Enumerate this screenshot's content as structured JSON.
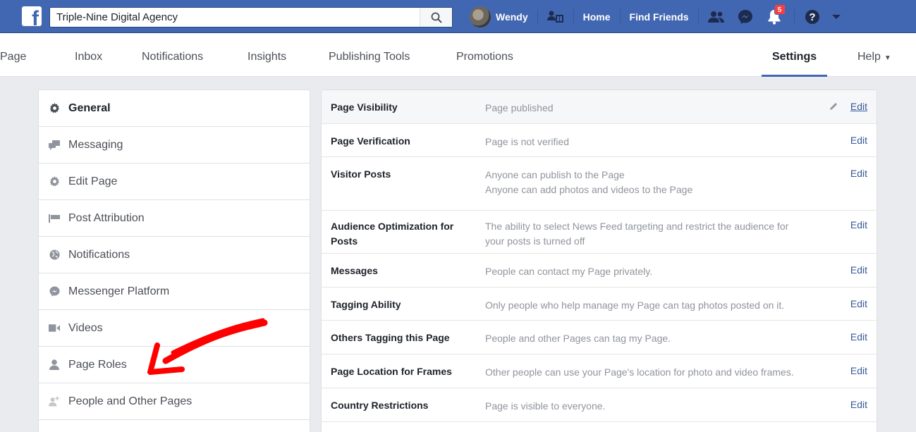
{
  "topbar": {
    "search_value": "Triple-Nine Digital Agency",
    "user_name": "Wendy",
    "home_label": "Home",
    "find_friends_label": "Find Friends",
    "notification_count": "5",
    "icons": [
      "facebook-logo",
      "search-icon",
      "friend-requests-icon",
      "messenger-icon",
      "notifications-icon",
      "help-icon",
      "account-menu-icon"
    ]
  },
  "pagenav": {
    "tabs": [
      "Page",
      "Inbox",
      "Notifications",
      "Insights",
      "Publishing Tools",
      "Promotions",
      "Settings",
      "Help"
    ],
    "active_tab": "Settings"
  },
  "sidebar": {
    "items": [
      {
        "label": "General",
        "icon": "gear-icon"
      },
      {
        "label": "Messaging",
        "icon": "chat-bubbles-icon"
      },
      {
        "label": "Edit Page",
        "icon": "gear-icon"
      },
      {
        "label": "Post Attribution",
        "icon": "flag-icon"
      },
      {
        "label": "Notifications",
        "icon": "globe-icon"
      },
      {
        "label": "Messenger Platform",
        "icon": "messenger-icon"
      },
      {
        "label": "Videos",
        "icon": "video-camera-icon"
      },
      {
        "label": "Page Roles",
        "icon": "person-icon"
      },
      {
        "label": "People and Other Pages",
        "icon": "person-add-icon"
      }
    ]
  },
  "settings": {
    "rows": [
      {
        "label": "Page Visibility",
        "value": "Page published",
        "edit": "Edit"
      },
      {
        "label": "Page Verification",
        "value": "Page is not verified",
        "edit": "Edit"
      },
      {
        "label": "Visitor Posts",
        "value": "Anyone can publish to the Page",
        "value2": "Anyone can add photos and videos to the Page",
        "edit": "Edit"
      },
      {
        "label": "Audience Optimization for",
        "label2": "Posts",
        "value": "The ability to select News Feed targeting and restrict the audience for",
        "value2": "your posts is turned off",
        "edit": "Edit"
      },
      {
        "label": "Messages",
        "value": "People can contact my Page privately.",
        "edit": "Edit"
      },
      {
        "label": "Tagging Ability",
        "value": "Only people who help manage my Page can tag photos posted on it.",
        "edit": "Edit"
      },
      {
        "label": "Others Tagging this Page",
        "value": "People and other Pages can tag my Page.",
        "edit": "Edit"
      },
      {
        "label": "Page Location for Frames",
        "value": "Other people can use your Page's location for photo and video frames.",
        "edit": "Edit"
      },
      {
        "label": "Country Restrictions",
        "value": "Page is visible to everyone.",
        "edit": "Edit"
      }
    ]
  },
  "colors": {
    "brand_blue": "#4267b2",
    "link_blue": "#365899",
    "annotation_red": "#ff0000",
    "badge_red": "#fa3e3e"
  }
}
